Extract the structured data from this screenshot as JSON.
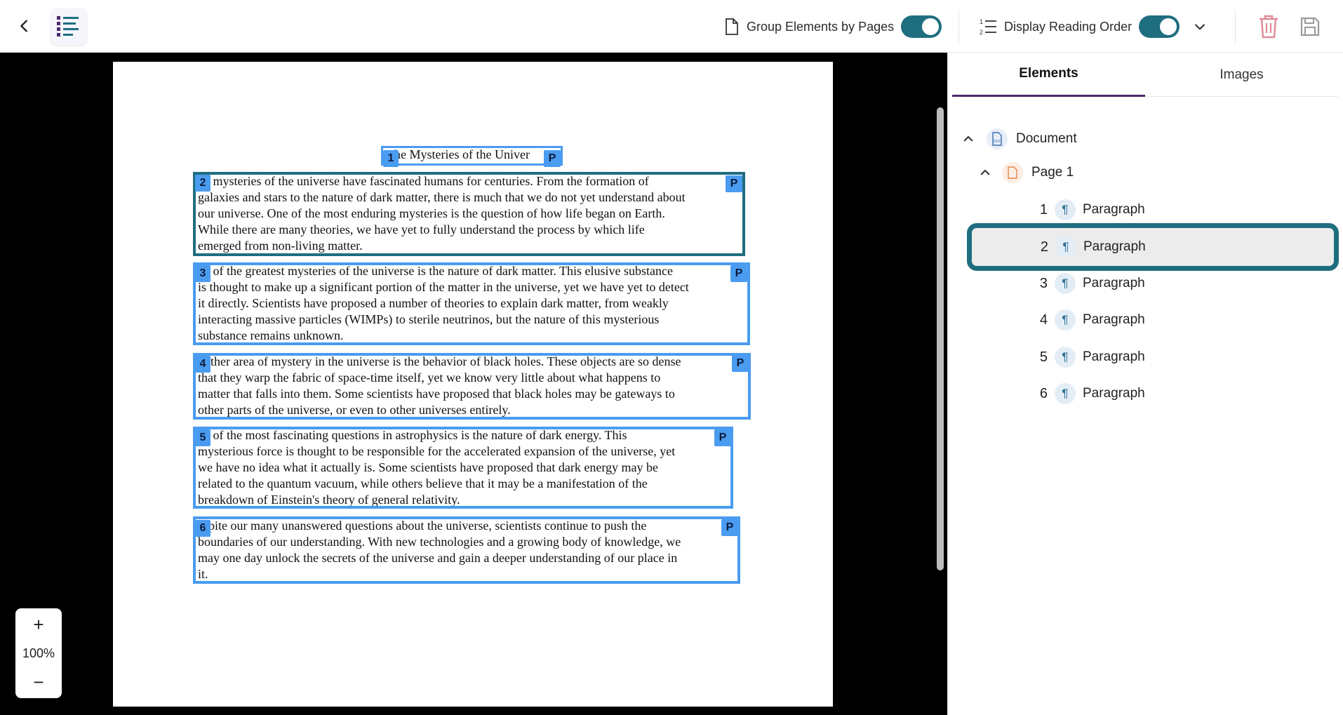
{
  "toolbar": {
    "group_by_pages_label": "Group Elements by Pages",
    "group_by_pages_on": true,
    "reading_order_label": "Display Reading Order",
    "reading_order_on": true
  },
  "document": {
    "title": "he Mysteries of the Univer",
    "paragraphs": [
      [
        "ne mysteries of the universe have fascinated humans for centuries. From the formation of",
        "galaxies and stars to the nature of dark matter, there is much that we do not yet understand about",
        "our universe. One of the most enduring mysteries is the question of how life began on Earth.",
        "While there are many theories, we have yet to fully understand the process by which life",
        "emerged from non-living matter."
      ],
      [
        "ne of the greatest mysteries of the universe is the nature of dark matter. This elusive substance",
        "is thought to make up a significant portion of the matter in the universe, yet we have yet to detect",
        "it directly. Scientists have proposed a number of theories to explain dark matter, from weakly",
        "interacting massive particles (WIMPs) to sterile neutrinos, but the nature of this mysterious",
        "substance remains unknown."
      ],
      [
        "nother area of mystery in the universe is the behavior of black holes. These objects are so dense",
        "that they warp the fabric of space-time itself, yet we know very little about what happens to",
        "matter that falls into them. Some scientists have proposed that black holes may be gateways to",
        "other parts of the universe, or even to other universes entirely."
      ],
      [
        "ne of the most fascinating questions in astrophysics is the nature of dark energy. This",
        "mysterious force is thought to be responsible for the accelerated expansion of the universe, yet",
        "we have no idea what it actually is. Some scientists have proposed that dark energy may be",
        "related to the quantum vacuum, while others believe that it may be a manifestation of the",
        "breakdown of Einstein's theory of general relativity."
      ],
      [
        "espite our many unanswered questions about the universe, scientists continue to push the",
        "boundaries of our understanding. With new technologies and a growing body of knowledge, we",
        "may one day unlock the secrets of the universe and gain a deeper understanding of our place in",
        "it."
      ]
    ],
    "badge_numbers": [
      "1",
      "2",
      "3",
      "4",
      "5",
      "6"
    ],
    "badge_type": "P"
  },
  "zoom": {
    "level": "100%",
    "plus": "+",
    "minus": "−"
  },
  "panel": {
    "tabs": [
      "Elements",
      "Images"
    ],
    "active_tab": "Elements",
    "tree": {
      "document_label": "Document",
      "page_label": "Page 1",
      "items": [
        {
          "num": "1",
          "label": "Paragraph"
        },
        {
          "num": "2",
          "label": "Paragraph"
        },
        {
          "num": "3",
          "label": "Paragraph"
        },
        {
          "num": "4",
          "label": "Paragraph"
        },
        {
          "num": "5",
          "label": "Paragraph"
        },
        {
          "num": "6",
          "label": "Paragraph"
        }
      ],
      "selected_item": "2"
    }
  },
  "colors": {
    "accent": "#1f6e80",
    "box": "#4a9cf0",
    "delete": "#e08a96",
    "tab_underline": "#4b2a6b"
  },
  "icons": {
    "back": "chevron-left-icon",
    "logo": "list-layout-icon",
    "page": "page-icon",
    "reading_order": "numbered-list-icon",
    "dropdown": "chevron-down-icon",
    "delete": "trash-icon",
    "save": "save-icon",
    "doc": "doc-icon",
    "paragraph": "pilcrow-icon"
  }
}
